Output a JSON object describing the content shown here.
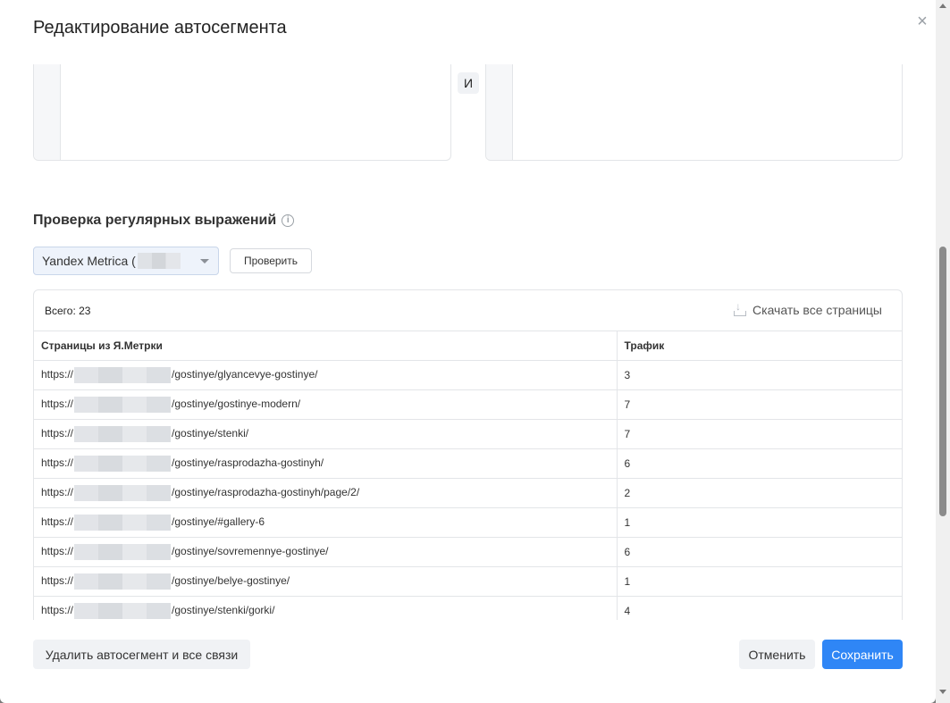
{
  "modal": {
    "title": "Редактирование автосегмента",
    "and_label": "И"
  },
  "regex_check": {
    "title": "Проверка регулярных выражений",
    "info_glyph": "i",
    "select_value": "Yandex Metrica (",
    "check_button": "Проверить"
  },
  "results": {
    "total": "Всего: 23",
    "download_label": "Скачать все страницы",
    "columns": [
      "Страницы из Я.Метрки",
      "Трафик"
    ],
    "rows": [
      {
        "prefix": "https://",
        "path": "/gostinye/glyancevye-gostinye/",
        "traffic": "3"
      },
      {
        "prefix": "https://",
        "path": "/gostinye/gostinye-modern/",
        "traffic": "7"
      },
      {
        "prefix": "https://",
        "path": "/gostinye/stenki/",
        "traffic": "7"
      },
      {
        "prefix": "https://",
        "path": "/gostinye/rasprodazha-gostinyh/",
        "traffic": "6"
      },
      {
        "prefix": "https://",
        "path": "/gostinye/rasprodazha-gostinyh/page/2/",
        "traffic": "2"
      },
      {
        "prefix": "https://",
        "path": "/gostinye/#gallery-6",
        "traffic": "1"
      },
      {
        "prefix": "https://",
        "path": "/gostinye/sovremennye-gostinye/",
        "traffic": "6"
      },
      {
        "prefix": "https://",
        "path": "/gostinye/belye-gostinye/",
        "traffic": "1"
      },
      {
        "prefix": "https://",
        "path": "/gostinye/stenki/gorki/",
        "traffic": "4"
      }
    ]
  },
  "footer": {
    "delete_button": "Удалить автосегмент и все связи",
    "cancel_button": "Отменить",
    "save_button": "Сохранить"
  },
  "colors": {
    "primary": "#2f86f6",
    "select_bg": "#eef3fb",
    "border": "#e3e5e8"
  },
  "icons": {
    "close": "×",
    "info": "info-icon",
    "download": "download-icon",
    "dropdown": "caret-down-icon"
  }
}
